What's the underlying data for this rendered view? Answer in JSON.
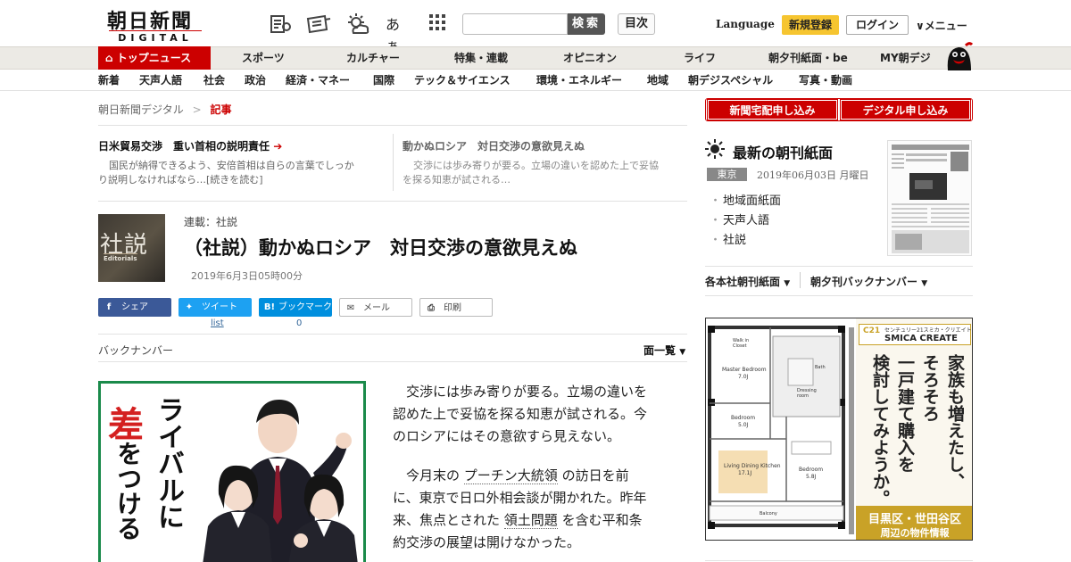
{
  "header": {
    "logo_main": "朝日新聞",
    "logo_sub": "DIGITAL",
    "font_toggle": "あぁ",
    "search_placeholder": "",
    "search_label": "検索",
    "toc_label": "目次",
    "language_label": "Language",
    "signup_label": "新規登録",
    "login_label": "ログイン",
    "menu_label": "メニュー"
  },
  "nav_primary": [
    "トップニュース",
    "スポーツ",
    "カルチャー",
    "特集・連載",
    "オピニオン",
    "ライフ",
    "朝夕刊紙面・be",
    "MY朝デジ"
  ],
  "nav_secondary": [
    "新着",
    "天声人語",
    "社会",
    "政治",
    "経済・マネー",
    "国際",
    "テック＆サイエンス",
    "環境・エネルギー",
    "地域",
    "朝デジスペシャル",
    "写真・動画"
  ],
  "breadcrumb": {
    "home": "朝日新聞デジタル",
    "sep": ">",
    "current": "記事"
  },
  "related": [
    {
      "title": "日米貿易交渉　重い首相の説明責任",
      "body_line1": "国民が納得できるよう、安倍首相は自らの言葉でしっか",
      "body_line2": "り説明しなければなら…[続きを読む]"
    },
    {
      "title": "動かぬロシア　対日交渉の意欲見えぬ",
      "body_line1": "交渉には歩み寄りが要る。立場の違いを認めた上で妥協",
      "body_line2": "を探る知恵が試される…"
    }
  ],
  "article": {
    "thumb_title": "社説",
    "thumb_sub": "Editorials",
    "series": "連載：社説",
    "headline": "（社説）動かぬロシア　対日交渉の意欲見えぬ",
    "date": "2019年6月3日05時00分",
    "share": {
      "facebook": "シェア",
      "twitter": "ツイート",
      "hatena": "ブックマーク",
      "mail": "メール",
      "print": "印刷",
      "twitter_count": "list",
      "hatena_count": "0"
    },
    "back_number": "バックナンバー",
    "list_all": "面一覧",
    "p1_l1": "交渉には歩み寄りが要る。立場の違いを",
    "p1_l2": "認めた上で妥協を探る知恵が試される。今",
    "p1_l3": "のロシアにはその意欲すら見えない。",
    "p2_l1a": "今月末の",
    "p2_kw1": "プーチン大統領",
    "p2_l1b": "の訪日を前",
    "p2_l2": "に、東京で日ロ外相会談が開かれた。昨年",
    "p2_l3a": "来、焦点とされた",
    "p2_kw2": "領土問題",
    "p2_l3b": "を含む平和条",
    "p2_l4": "約交渉の展望は開けなかった。"
  },
  "ad_left": {
    "line1": "ライバルに",
    "line2": "差",
    "line3": "をつける"
  },
  "sidebar": {
    "subscribe_paper": "新聞宅配申し込み",
    "subscribe_digital": "デジタル申し込み",
    "paper_title": "最新の朝刊紙面",
    "city": "東京",
    "paper_date": "2019年06月03日 月曜日",
    "links": [
      "地域面紙面",
      "天声人語",
      "社説"
    ],
    "dd_regional": "各本社朝刊紙面",
    "dd_backnumber": "朝夕刊バックナンバー"
  },
  "ad_right": {
    "brand_top": "センチュリー21スミカ・クリエイト",
    "brand_name": "SMICA CREATE",
    "copy_col1": "家族も増えたし、",
    "copy_col2": "そろそろ",
    "copy_col3": "一戸建て購入を",
    "copy_col4": "検討してみようか。",
    "area": "目黒区・世田谷区",
    "area_sub": "周辺の物件情報",
    "rooms": [
      "Walk in Closet",
      "Master Bedroom",
      "7.0J",
      "Bedroom",
      "5.0J",
      "Living Dining Kitchen",
      "17.1J",
      "Bedroom",
      "5.8J",
      "Balcony",
      "Bath",
      "Dressing room"
    ]
  },
  "colors": {
    "accent_red": "#cc0000",
    "ad_green": "#1a8a4a",
    "signup_yellow": "#f6c530",
    "ad_gold": "#c9a227"
  }
}
